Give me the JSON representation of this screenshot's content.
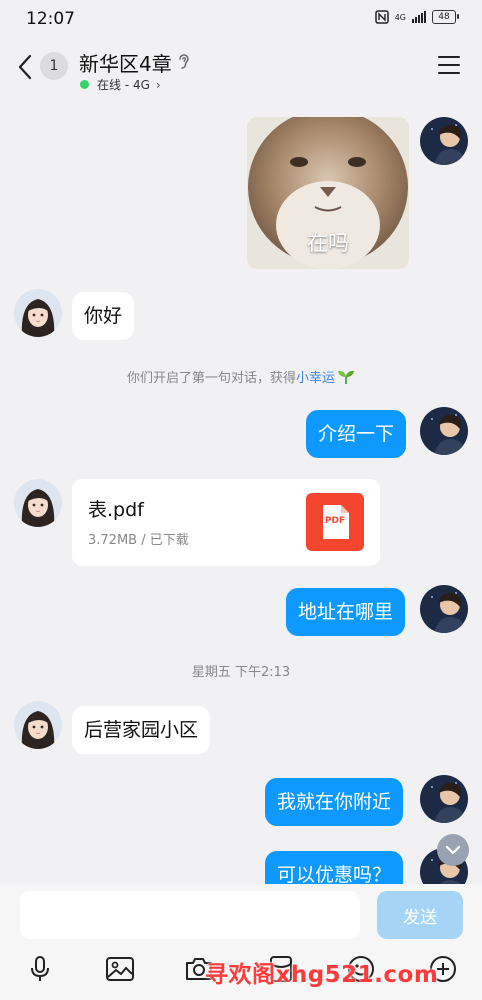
{
  "status_bar": {
    "time": "12:07",
    "network": "4G",
    "battery": "48"
  },
  "header": {
    "unread_count": "1",
    "title": "新华区4章",
    "presence": "在线 - 4G",
    "presence_color": "#35d266"
  },
  "messages": {
    "sticker_caption": "在吗",
    "hello": "你好",
    "system_note_prefix": "你们开启了第一句对话，获得",
    "system_note_link": "小幸运",
    "intro": "介绍一下",
    "file_name": "表.pdf",
    "file_meta": "3.72MB / 已下载",
    "file_badge": "PDF",
    "address_question": "地址在哪里",
    "timestamp": "星期五 下午2:13",
    "address_reply": "后营家园小区",
    "nearby": "我就在你附近",
    "discount": "可以优惠吗？"
  },
  "colors": {
    "outgoing_bubble": "#0d99ff",
    "incoming_bubble": "#ffffff",
    "background": "#f1f1f3",
    "link": "#3d86e5",
    "pdf_icon": "#f4462e",
    "send_button": "#a6d4f7"
  },
  "input": {
    "placeholder": "",
    "send_label": "发送"
  },
  "toolbar": {
    "icons": [
      "microphone-icon",
      "image-icon",
      "camera-icon",
      "red-packet-icon",
      "emoji-icon",
      "plus-icon"
    ]
  },
  "watermark": "寻欢阁xhg521.com"
}
